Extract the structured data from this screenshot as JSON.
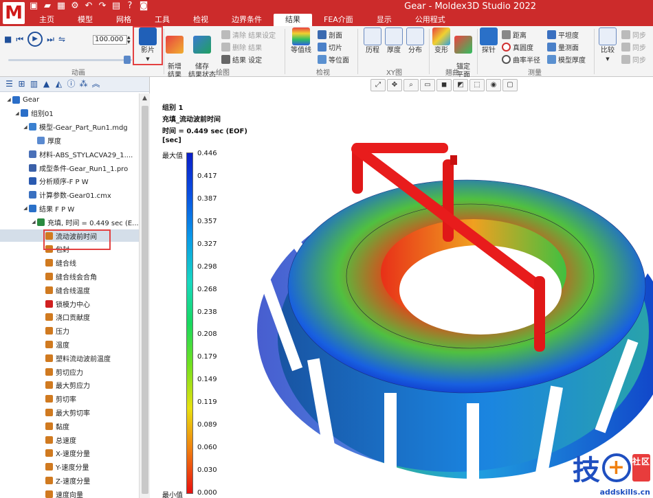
{
  "app": {
    "logo": "M",
    "window_title": "Gear - Moldex3D Studio 2022"
  },
  "tabs": [
    {
      "label": "主页"
    },
    {
      "label": "模型"
    },
    {
      "label": "网格"
    },
    {
      "label": "工具"
    },
    {
      "label": "检视"
    },
    {
      "label": "边界条件"
    },
    {
      "label": "结果"
    },
    {
      "label": "FEA介面"
    },
    {
      "label": "显示"
    },
    {
      "label": "公用程式"
    }
  ],
  "active_tab": "结果",
  "ribbon": {
    "animation": {
      "speed_value": "100.000",
      "movie_label": "影片",
      "group_label": "动画"
    },
    "plot": {
      "new_result": "新增\n结果",
      "save_state": "储存\n结果状态",
      "clear_settings": "清除 结果设定",
      "delete_result": "删除 结果",
      "result_settings": "结果 设定",
      "group_label": "绘图"
    },
    "view": {
      "contour": "等值线",
      "section": "剖面",
      "cut": "切片",
      "iso": "等位面",
      "group_label": "检视"
    },
    "xy": {
      "history": "历程",
      "thickness": "厚度",
      "distribution": "分布",
      "group_label": "XY图"
    },
    "warp": {
      "deform": "变形",
      "anchor_plane": "锚定\n平面",
      "group_label": "翘曲"
    },
    "measure": {
      "probe": "探针",
      "distance": "距离",
      "roundness": "真圆度",
      "curvature": "曲率半径",
      "flatness": "平坦度",
      "surface_measure": "量测面",
      "model_thickness": "模型厚度",
      "group_label": "测量"
    },
    "compare": {
      "compare": "比较",
      "sync1": "同步",
      "sync2": "同步",
      "sync3": "同步"
    }
  },
  "tree": [
    {
      "label": "Gear",
      "icon": "folder-icon",
      "indent": 0,
      "twist": "◢"
    },
    {
      "label": "组别01",
      "icon": "group-icon",
      "indent": 1,
      "twist": "◢"
    },
    {
      "label": "模型-Gear_Part_Run1.mdg",
      "icon": "model-icon",
      "indent": 2,
      "twist": "◢"
    },
    {
      "label": "厚度",
      "icon": "thickness-icon",
      "indent": 3,
      "twist": ""
    },
    {
      "label": "材料-ABS_STYLACVA29_1....",
      "icon": "material-icon",
      "indent": 2,
      "twist": ""
    },
    {
      "label": "成型条件-Gear_Run1_1.pro",
      "icon": "process-icon",
      "indent": 2,
      "twist": ""
    },
    {
      "label": "分析顺序-F P W",
      "icon": "sequence-icon",
      "indent": 2,
      "twist": ""
    },
    {
      "label": "计算参数-Gear01.cmx",
      "icon": "params-icon",
      "indent": 2,
      "twist": ""
    },
    {
      "label": "结果  F P W",
      "icon": "results-icon",
      "indent": 2,
      "twist": "◢"
    },
    {
      "label": "充填, 时间 = 0.449 sec (E...",
      "icon": "filling-icon",
      "indent": 3,
      "twist": "◢"
    },
    {
      "label": "流动波前时间",
      "icon": "result-item-icon",
      "indent": 4,
      "twist": "",
      "selected": true
    },
    {
      "label": "包封",
      "icon": "result-item-icon",
      "indent": 4,
      "twist": ""
    },
    {
      "label": "缝合线",
      "icon": "result-item-icon",
      "indent": 4,
      "twist": ""
    },
    {
      "label": "缝合线会合角",
      "icon": "result-item-icon",
      "indent": 4,
      "twist": ""
    },
    {
      "label": "缝合线温度",
      "icon": "result-item-icon",
      "indent": 4,
      "twist": ""
    },
    {
      "label": "锁模力中心",
      "icon": "target-icon",
      "indent": 4,
      "twist": ""
    },
    {
      "label": "浇口贡献度",
      "icon": "result-item-icon",
      "indent": 4,
      "twist": ""
    },
    {
      "label": "压力",
      "icon": "result-item-icon",
      "indent": 4,
      "twist": ""
    },
    {
      "label": "温度",
      "icon": "result-item-icon",
      "indent": 4,
      "twist": ""
    },
    {
      "label": "塑料流动波前温度",
      "icon": "result-item-icon",
      "indent": 4,
      "twist": ""
    },
    {
      "label": "剪切应力",
      "icon": "result-item-icon",
      "indent": 4,
      "twist": ""
    },
    {
      "label": "最大剪应力",
      "icon": "result-item-icon",
      "indent": 4,
      "twist": ""
    },
    {
      "label": "剪切率",
      "icon": "result-item-icon",
      "indent": 4,
      "twist": ""
    },
    {
      "label": "最大剪切率",
      "icon": "result-item-icon",
      "indent": 4,
      "twist": ""
    },
    {
      "label": "黏度",
      "icon": "result-item-icon",
      "indent": 4,
      "twist": ""
    },
    {
      "label": "总速度",
      "icon": "result-item-icon",
      "indent": 4,
      "twist": ""
    },
    {
      "label": "X-速度分量",
      "icon": "result-item-icon",
      "indent": 4,
      "twist": ""
    },
    {
      "label": "Y-速度分量",
      "icon": "result-item-icon",
      "indent": 4,
      "twist": ""
    },
    {
      "label": "Z-速度分量",
      "icon": "result-item-icon",
      "indent": 4,
      "twist": ""
    },
    {
      "label": "速度向量",
      "icon": "result-item-icon",
      "indent": 4,
      "twist": ""
    }
  ],
  "viewport": {
    "group": "组别 1",
    "result_name": "充填_流动波前时间",
    "time": "时间 = 0.449 sec (EOF)",
    "unit": "[sec]",
    "max_label": "最大值",
    "min_label": "最小值",
    "legend_values": [
      "0.446",
      "0.417",
      "0.387",
      "0.357",
      "0.327",
      "0.298",
      "0.268",
      "0.238",
      "0.208",
      "0.179",
      "0.149",
      "0.119",
      "0.089",
      "0.060",
      "0.030",
      "0.000"
    ]
  },
  "watermark": {
    "text": "技",
    "badge": "社区",
    "url": "addskills.cn"
  }
}
